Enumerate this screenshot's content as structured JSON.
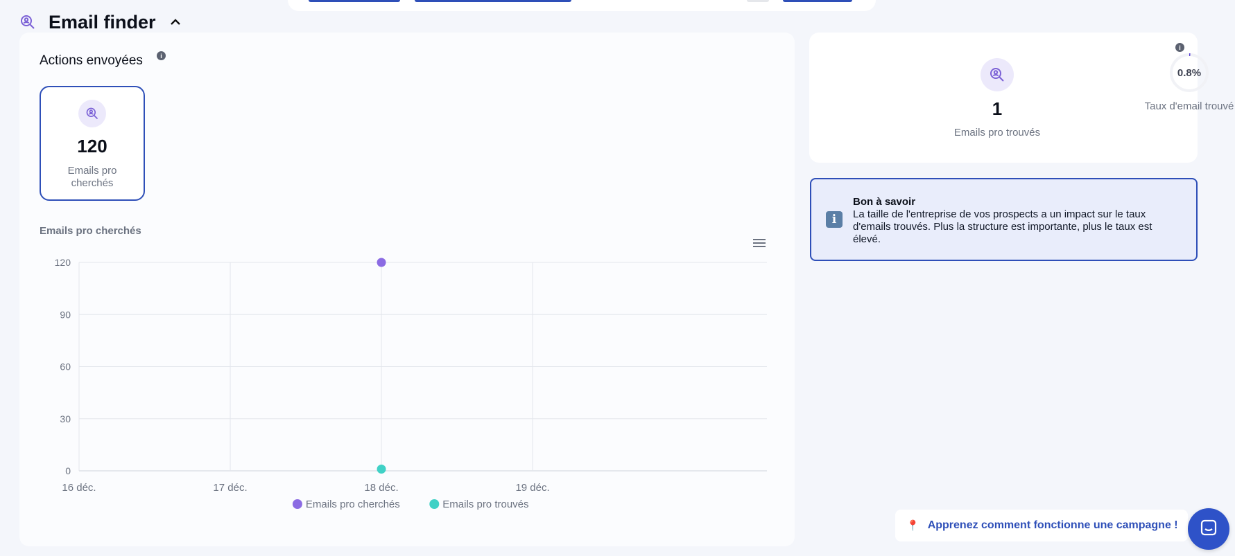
{
  "section": {
    "title": "Email finder",
    "icon": "search-user-icon",
    "toggle_icon": "chevron-up-icon"
  },
  "actions": {
    "title": "Actions envoyées",
    "info_icon": "info-icon",
    "stat": {
      "value": "120",
      "label": "Emails pro cherchés",
      "icon": "search-user-icon"
    }
  },
  "chart_title": "Emails pro cherchés",
  "chart_data": {
    "type": "scatter",
    "x": [
      "16 déc.",
      "17 déc.",
      "18 déc.",
      "19 déc."
    ],
    "yticks": [
      0,
      30,
      60,
      90,
      120
    ],
    "ylim": [
      0,
      120
    ],
    "grid": true,
    "legend": "bottom-center",
    "series": [
      {
        "name": "Emails pro cherchés",
        "color": "#8b6be3",
        "points": [
          {
            "x": "18 déc.",
            "y": 120
          }
        ]
      },
      {
        "name": "Emails pro trouvés",
        "color": "#40d1c6",
        "points": [
          {
            "x": "18 déc.",
            "y": 1
          }
        ]
      }
    ]
  },
  "stats_card": {
    "found": {
      "value": "1",
      "label": "Emails pro trouvés",
      "icon": "search-user-icon"
    },
    "rate": {
      "value": "0.8%",
      "label": "Taux d'email trouvé",
      "fraction": 0.008
    }
  },
  "tip": {
    "title": "Bon à savoir",
    "text": "La taille de l'entreprise de vos prospects a un impact sur le taux d'emails trouvés. Plus la structure est importante, plus le taux est élevé.",
    "icon": "info-icon"
  },
  "campaign_link": {
    "text": "Apprenez comment fonctionne une campagne !",
    "icon": "pin-icon"
  },
  "chat": {
    "icon": "chat-icon"
  },
  "colors": {
    "accent": "#2e4fb8",
    "purple": "#8b6be3",
    "teal": "#40d1c6",
    "icon_bg": "#ece9fb"
  }
}
